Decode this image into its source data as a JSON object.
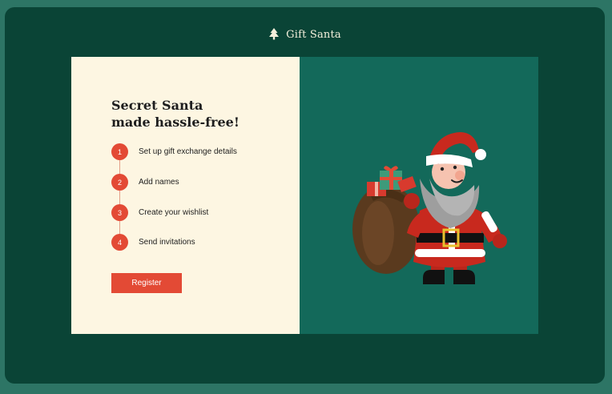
{
  "header": {
    "brand": "Gift Santa",
    "logo_icon": "tree-icon"
  },
  "hero": {
    "title_line1": "Secret Santa",
    "title_line2": "made hassle-free!"
  },
  "steps": [
    {
      "num": "1",
      "label": "Set up gift exchange details"
    },
    {
      "num": "2",
      "label": "Add names"
    },
    {
      "num": "3",
      "label": "Create your wishlist"
    },
    {
      "num": "4",
      "label": "Send invitations"
    }
  ],
  "cta": {
    "register_label": "Register"
  },
  "illustration": {
    "name": "santa-illustration"
  },
  "colors": {
    "page_bg": "#2d7565",
    "frame_bg": "#0a4436",
    "left_panel": "#fdf6e2",
    "right_panel": "#13695a",
    "accent": "#e34a35"
  }
}
